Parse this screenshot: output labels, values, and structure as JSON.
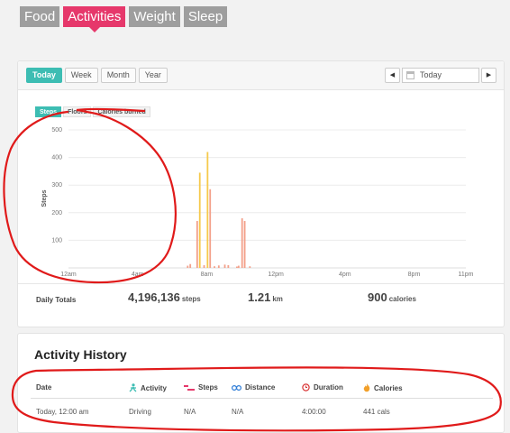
{
  "nav": {
    "tabs": [
      {
        "label": "Food"
      },
      {
        "label": "Activities"
      },
      {
        "label": "Weight"
      },
      {
        "label": "Sleep"
      }
    ],
    "active": "Activities"
  },
  "toolbar": {
    "ranges": [
      {
        "label": "Today"
      },
      {
        "label": "Week"
      },
      {
        "label": "Month"
      },
      {
        "label": "Year"
      }
    ],
    "active_range": "Today",
    "date_value": "Today",
    "prev_icon": "triangle-left-icon",
    "next_icon": "triangle-right-icon",
    "calendar_icon": "calendar-icon"
  },
  "metrics": {
    "tabs": [
      {
        "label": "Steps"
      },
      {
        "label": "Floors"
      },
      {
        "label": "Calories burned"
      }
    ],
    "active": "Steps"
  },
  "chart_data": {
    "type": "bar",
    "ylabel": "Steps",
    "xlabel": "",
    "ylim": [
      0,
      500
    ],
    "yticks": [
      "500",
      "400",
      "300",
      "200",
      "100"
    ],
    "xticks": [
      "12am",
      "4am",
      "8am",
      "12pm",
      "4pm",
      "8pm",
      "11pm"
    ],
    "grid": true,
    "x_unit": "hour of day",
    "bars": [
      {
        "x": 6.9,
        "y": 8
      },
      {
        "x": 7.05,
        "y": 14
      },
      {
        "x": 7.45,
        "y": 170
      },
      {
        "x": 7.6,
        "y": 345
      },
      {
        "x": 7.85,
        "y": 10
      },
      {
        "x": 8.05,
        "y": 420
      },
      {
        "x": 8.2,
        "y": 285
      },
      {
        "x": 8.45,
        "y": 6
      },
      {
        "x": 8.7,
        "y": 9
      },
      {
        "x": 9.05,
        "y": 12
      },
      {
        "x": 9.25,
        "y": 10
      },
      {
        "x": 9.75,
        "y": 5
      },
      {
        "x": 9.85,
        "y": 8
      },
      {
        "x": 10.05,
        "y": 180
      },
      {
        "x": 10.2,
        "y": 170
      },
      {
        "x": 10.5,
        "y": 6
      }
    ],
    "colors": {
      "low": "#f3a08a",
      "high": "#f6c94c"
    }
  },
  "totals": {
    "label": "Daily Totals",
    "steps": {
      "value": "4,196,136",
      "unit": "steps"
    },
    "distance": {
      "value": "1.21",
      "unit": "km"
    },
    "calories": {
      "value": "900",
      "unit": "calories"
    }
  },
  "history": {
    "title": "Activity History",
    "columns": {
      "date": "Date",
      "activity": "Activity",
      "steps": "Steps",
      "distance": "Distance",
      "duration": "Duration",
      "calories": "Calories"
    },
    "column_icons": {
      "activity": "person-icon",
      "steps": "shoe-icon",
      "distance": "footprints-icon",
      "duration": "clock-icon",
      "calories": "flame-icon"
    },
    "rows": [
      {
        "date": "Today, 12:00 am",
        "activity": "Driving",
        "steps": "N/A",
        "distance": "N/A",
        "duration": "4:00:00",
        "calories": "441 cals"
      }
    ]
  },
  "colors": {
    "accent": "#3dbdb3",
    "nav_active": "#e6386b",
    "annotation": "#e01a1a"
  }
}
